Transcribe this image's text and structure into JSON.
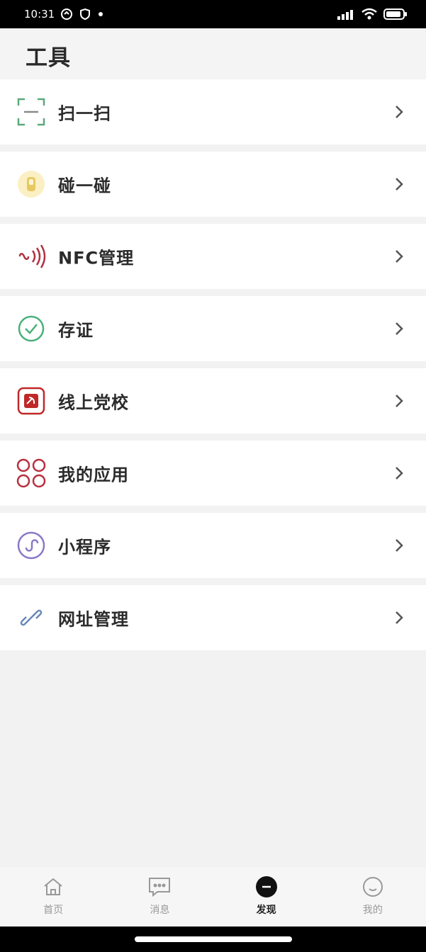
{
  "status_bar": {
    "time": "10:31",
    "left_icons": [
      "sync-icon",
      "shield-icon",
      "dot-icon"
    ],
    "right_icons": [
      "signal-icon",
      "wifi-icon",
      "battery-icon"
    ]
  },
  "header": {
    "title": "工具"
  },
  "items": [
    {
      "label": "扫一扫",
      "icon": "scan-icon",
      "color": "#5aaa7a"
    },
    {
      "label": "碰一碰",
      "icon": "touch-icon",
      "color": "#e8c860"
    },
    {
      "label": "NFC管理",
      "icon": "nfc-icon",
      "color": "#b03040"
    },
    {
      "label": "存证",
      "icon": "certificate-check-icon",
      "color": "#4ab07a"
    },
    {
      "label": "线上党校",
      "icon": "party-school-icon",
      "color": "#c02828"
    },
    {
      "label": "我的应用",
      "icon": "apps-grid-icon",
      "color": "#b83040"
    },
    {
      "label": "小程序",
      "icon": "mini-program-icon",
      "color": "#8a78c8"
    },
    {
      "label": "网址管理",
      "icon": "link-icon",
      "color": "#6a88b8"
    }
  ],
  "tabbar": {
    "tabs": [
      {
        "label": "首页",
        "icon": "home-icon",
        "active": false
      },
      {
        "label": "消息",
        "icon": "message-icon",
        "active": false
      },
      {
        "label": "发现",
        "icon": "discover-icon",
        "active": true
      },
      {
        "label": "我的",
        "icon": "profile-icon",
        "active": false
      }
    ],
    "active_color": "#111111",
    "inactive_color": "#999999"
  }
}
